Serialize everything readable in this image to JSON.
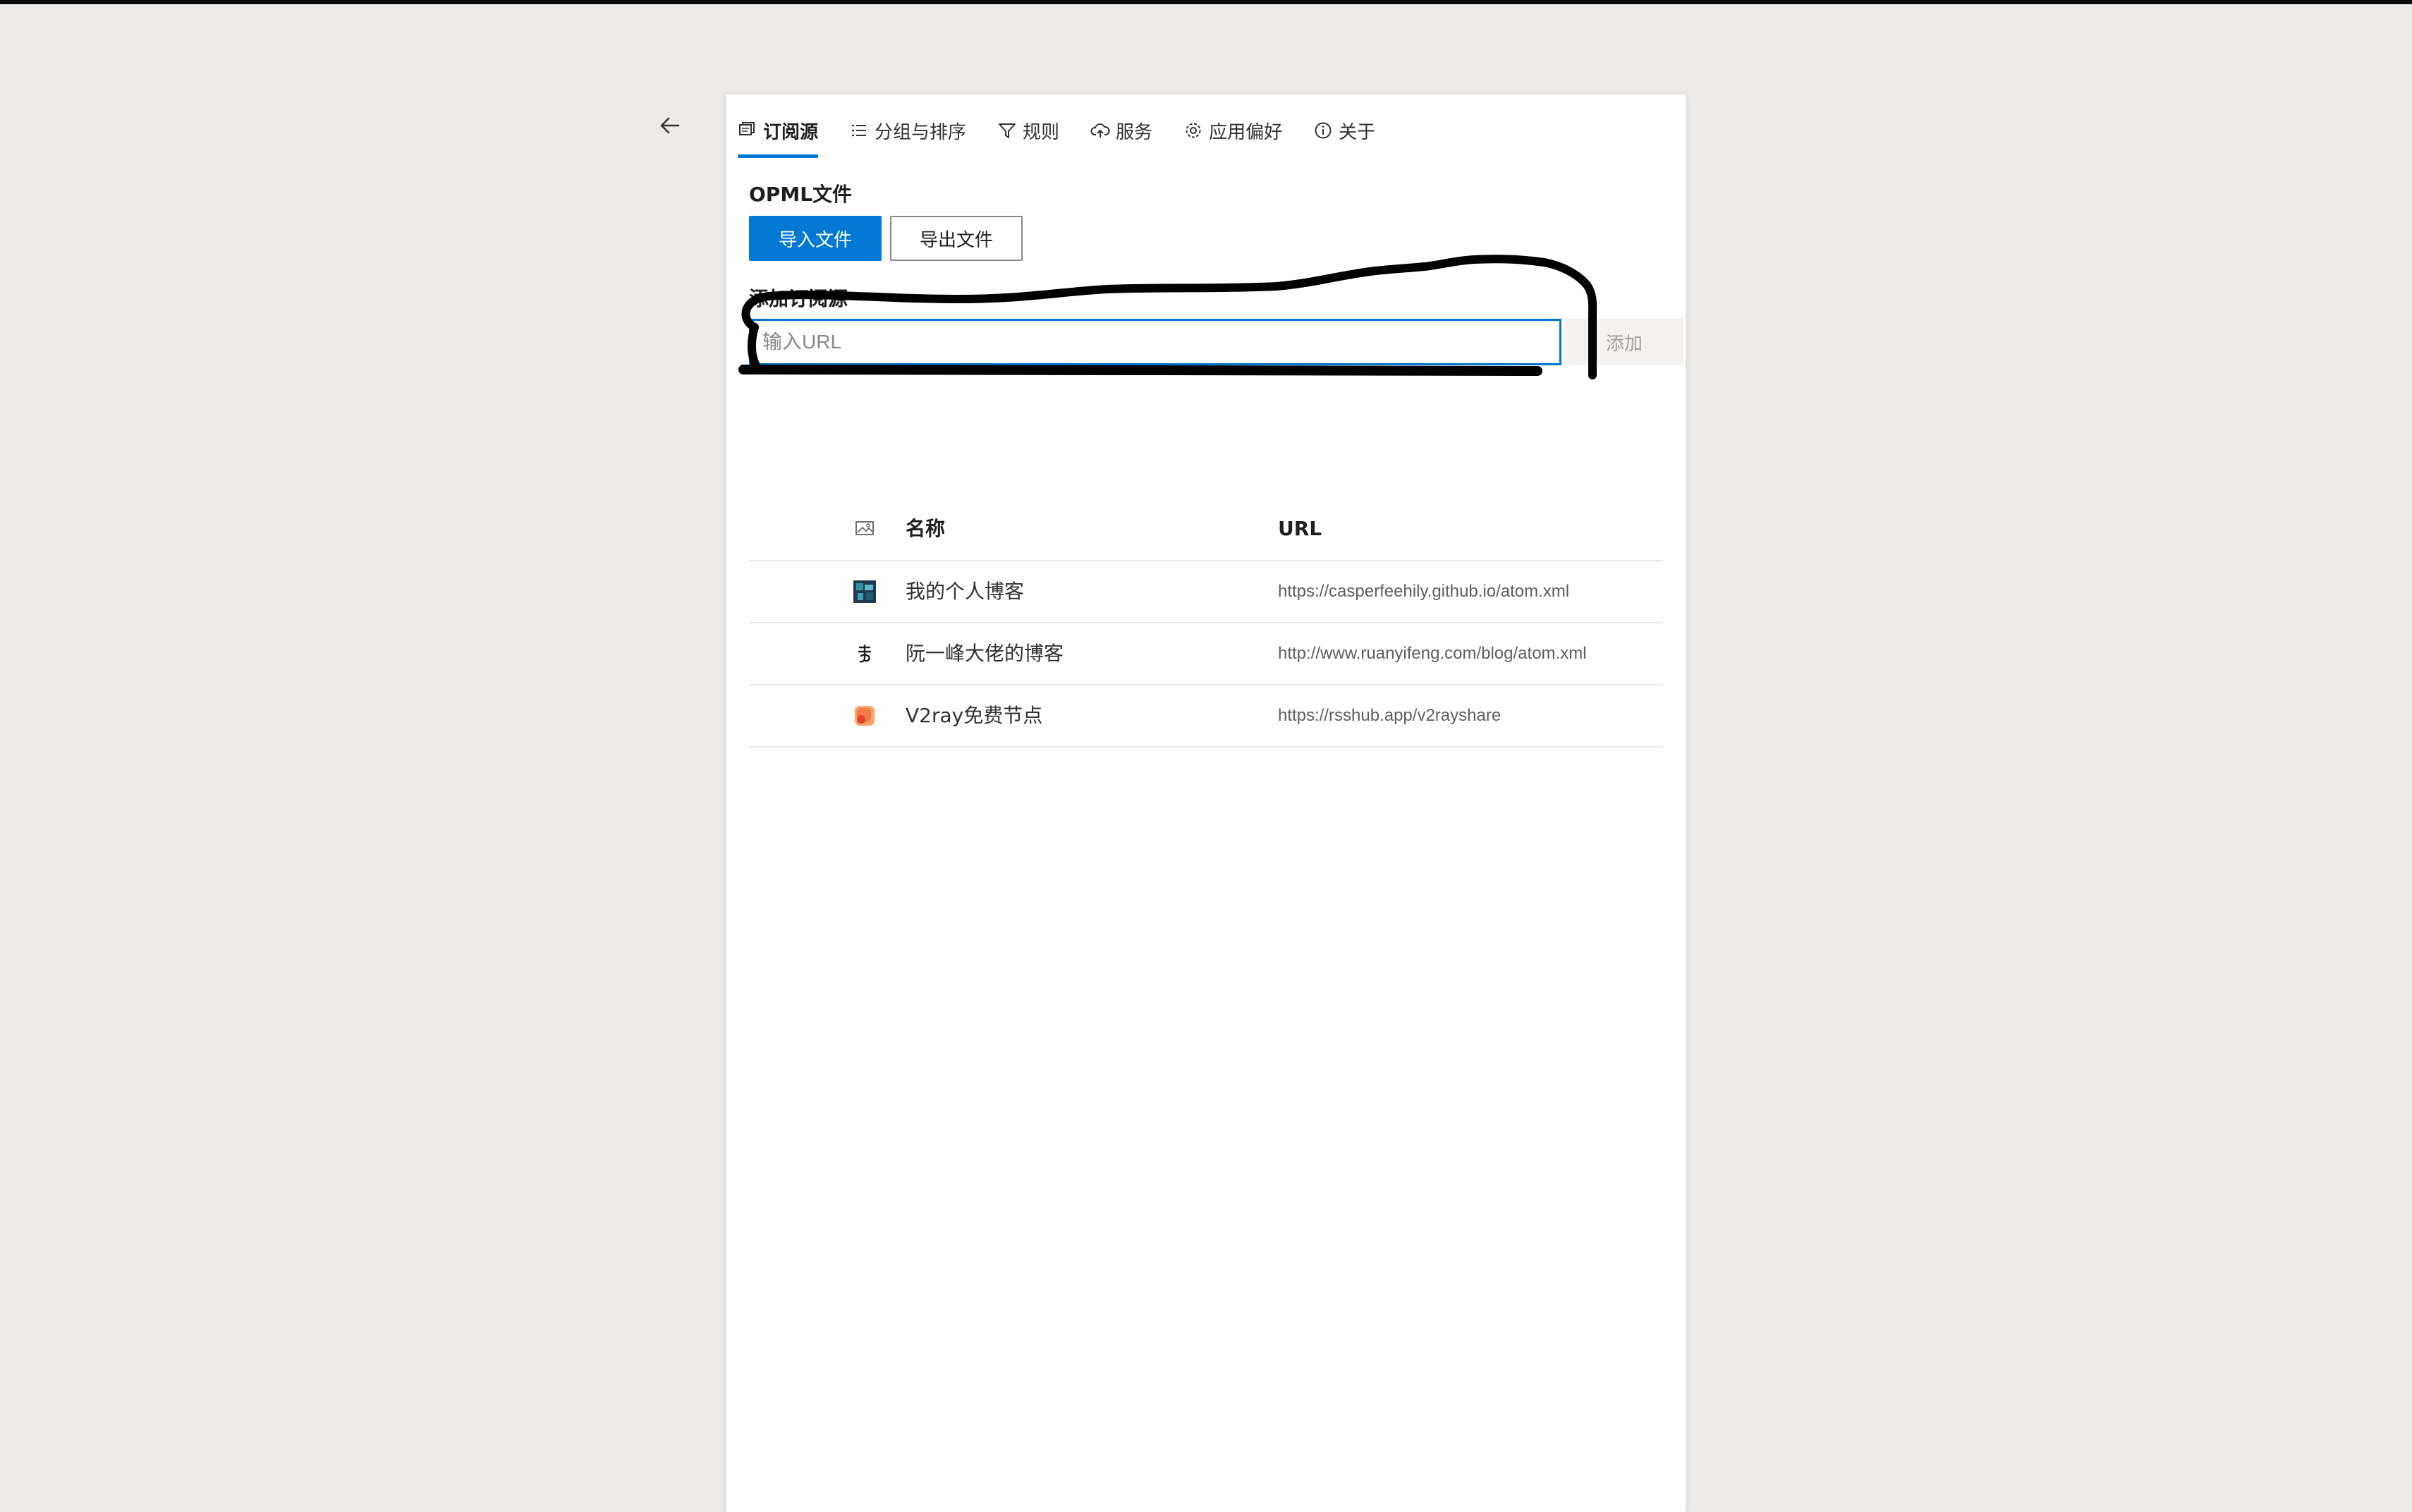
{
  "nav": {
    "back_icon": "arrow-left-icon"
  },
  "tabs": [
    {
      "label": "订阅源",
      "icon": "feeds-icon",
      "active": true
    },
    {
      "label": "分组与排序",
      "icon": "list-icon",
      "active": false
    },
    {
      "label": "规则",
      "icon": "filter-icon",
      "active": false
    },
    {
      "label": "服务",
      "icon": "cloud-sync-icon",
      "active": false
    },
    {
      "label": "应用偏好",
      "icon": "gear-icon",
      "active": false
    },
    {
      "label": "关于",
      "icon": "info-icon",
      "active": false
    }
  ],
  "opml": {
    "title": "OPML文件",
    "import_label": "导入文件",
    "export_label": "导出文件"
  },
  "add_source": {
    "title": "添加订阅源",
    "placeholder": "输入URL",
    "value": "",
    "button_label": "添加"
  },
  "table": {
    "header": {
      "icon": "image-icon",
      "name": "名称",
      "url": "URL"
    },
    "rows": [
      {
        "icon": "personal-blog-favicon",
        "name": "我的个人博客",
        "url": "https://casperfeehily.github.io/atom.xml"
      },
      {
        "icon": "ruanyifeng-favicon",
        "name": "阮一峰大佬的博客",
        "url": "http://www.ruanyifeng.com/blog/atom.xml"
      },
      {
        "icon": "rsshub-favicon",
        "name": "V2ray免费节点",
        "url": "https://rsshub.app/v2rayshare"
      }
    ]
  },
  "colors": {
    "accent": "#0078d4",
    "background": "#edebe9",
    "panel": "#ffffff",
    "annotation": "#000000"
  }
}
